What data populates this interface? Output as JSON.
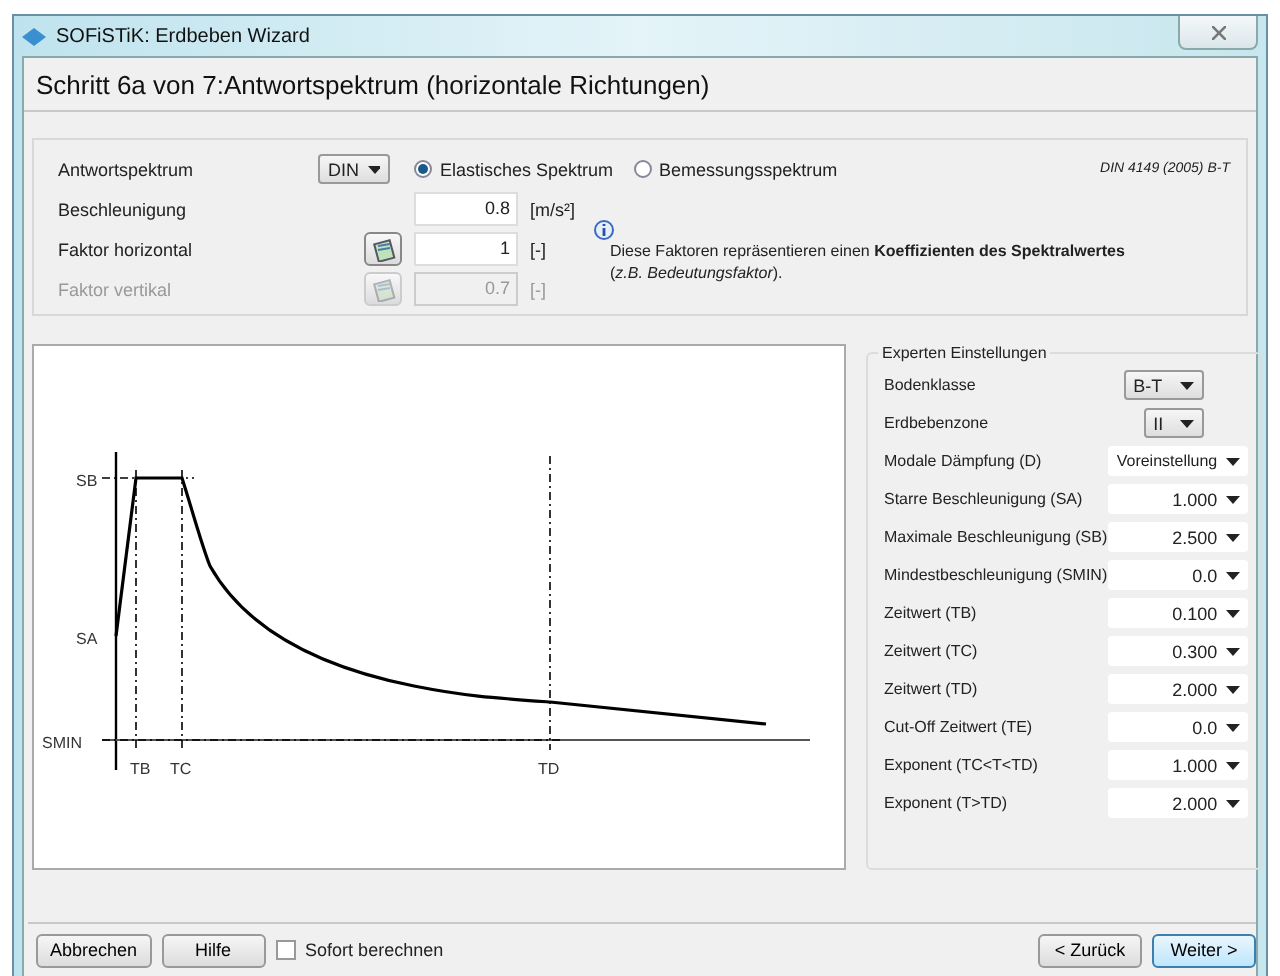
{
  "window": {
    "title": "SOFiSTiK: Erdbeben Wizard"
  },
  "header": {
    "title": "Schritt 6a von 7:Antwortspektrum (horizontale Richtungen)"
  },
  "spectrum": {
    "label": "Antwortspektrum",
    "value": "DIN",
    "norm": "DIN 4149 (2005) B-T",
    "radios": [
      {
        "label": "Elastisches Spektrum",
        "selected": true
      },
      {
        "label": "Bemessungsspektrum",
        "selected": false
      }
    ]
  },
  "factors": [
    {
      "label": "Beschleunigung",
      "value": "0.8",
      "unit": "[m/s²]",
      "button": false,
      "disabled": false
    },
    {
      "label": "Faktor horizontal",
      "value": "1",
      "unit": "[-]",
      "button": true,
      "disabled": false
    },
    {
      "label": "Faktor vertikal",
      "value": "0.7",
      "unit": "[-]",
      "button": true,
      "disabled": true
    }
  ],
  "info": {
    "lines": [
      "Diese Faktoren repräsentieren einen **Koeffizienten des Spektralwertes**",
      "(*z.B. Bedeutungsfaktor*)."
    ]
  },
  "chart": {
    "y_labels": [
      "SB",
      "SA",
      "SMIN"
    ],
    "x_labels": [
      "TB",
      "TC",
      "TD"
    ]
  },
  "expert": {
    "title": "Experten Einstellungen",
    "rows": [
      {
        "label": "Bodenklasse",
        "value": "B-T",
        "kind": "select"
      },
      {
        "label": "Erdbebenzone",
        "value": "II",
        "kind": "select"
      },
      {
        "label": "Modale Dämpfung (D)",
        "value": "Voreinstellung",
        "kind": "combo"
      },
      {
        "label": "Starre Beschleunigung (SA)",
        "value": "1.000",
        "kind": "combo"
      },
      {
        "label": "Maximale Beschleunigung (SB)",
        "value": "2.500",
        "kind": "combo"
      },
      {
        "label": "Mindestbeschleunigung (SMIN)",
        "value": "0.0",
        "kind": "combo"
      },
      {
        "label": "Zeitwert (TB)",
        "value": "0.100",
        "kind": "combo"
      },
      {
        "label": "Zeitwert (TC)",
        "value": "0.300",
        "kind": "combo"
      },
      {
        "label": "Zeitwert (TD)",
        "value": "2.000",
        "kind": "combo"
      },
      {
        "label": "Cut-Off Zeitwert (TE)",
        "value": "0.0",
        "kind": "combo"
      },
      {
        "label": "Exponent (TC<T<TD)",
        "value": "1.000",
        "kind": "combo"
      },
      {
        "label": "Exponent (T>TD)",
        "value": "2.000",
        "kind": "combo"
      }
    ]
  },
  "footer": {
    "left_buttons": [
      "Abbrechen",
      "Hilfe"
    ],
    "checkbox": {
      "label": "Sofort berechnen",
      "checked": false
    },
    "right_buttons": [
      {
        "label": "< Zurück",
        "default": false
      },
      {
        "label": "Weiter >",
        "default": true
      }
    ]
  }
}
